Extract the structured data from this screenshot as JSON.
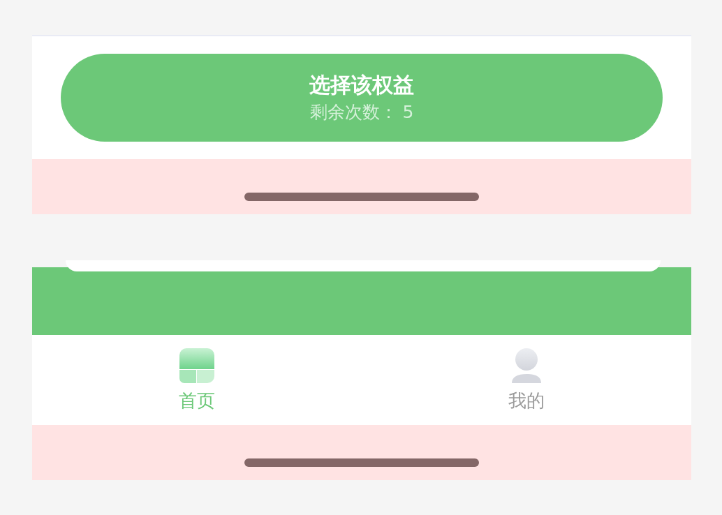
{
  "action_button": {
    "title": "选择该权益",
    "subtitle": "剩余次数： 5"
  },
  "tab_bar": {
    "tabs": [
      {
        "label": "首页",
        "selected": true
      },
      {
        "label": "我的",
        "selected": false
      }
    ]
  }
}
